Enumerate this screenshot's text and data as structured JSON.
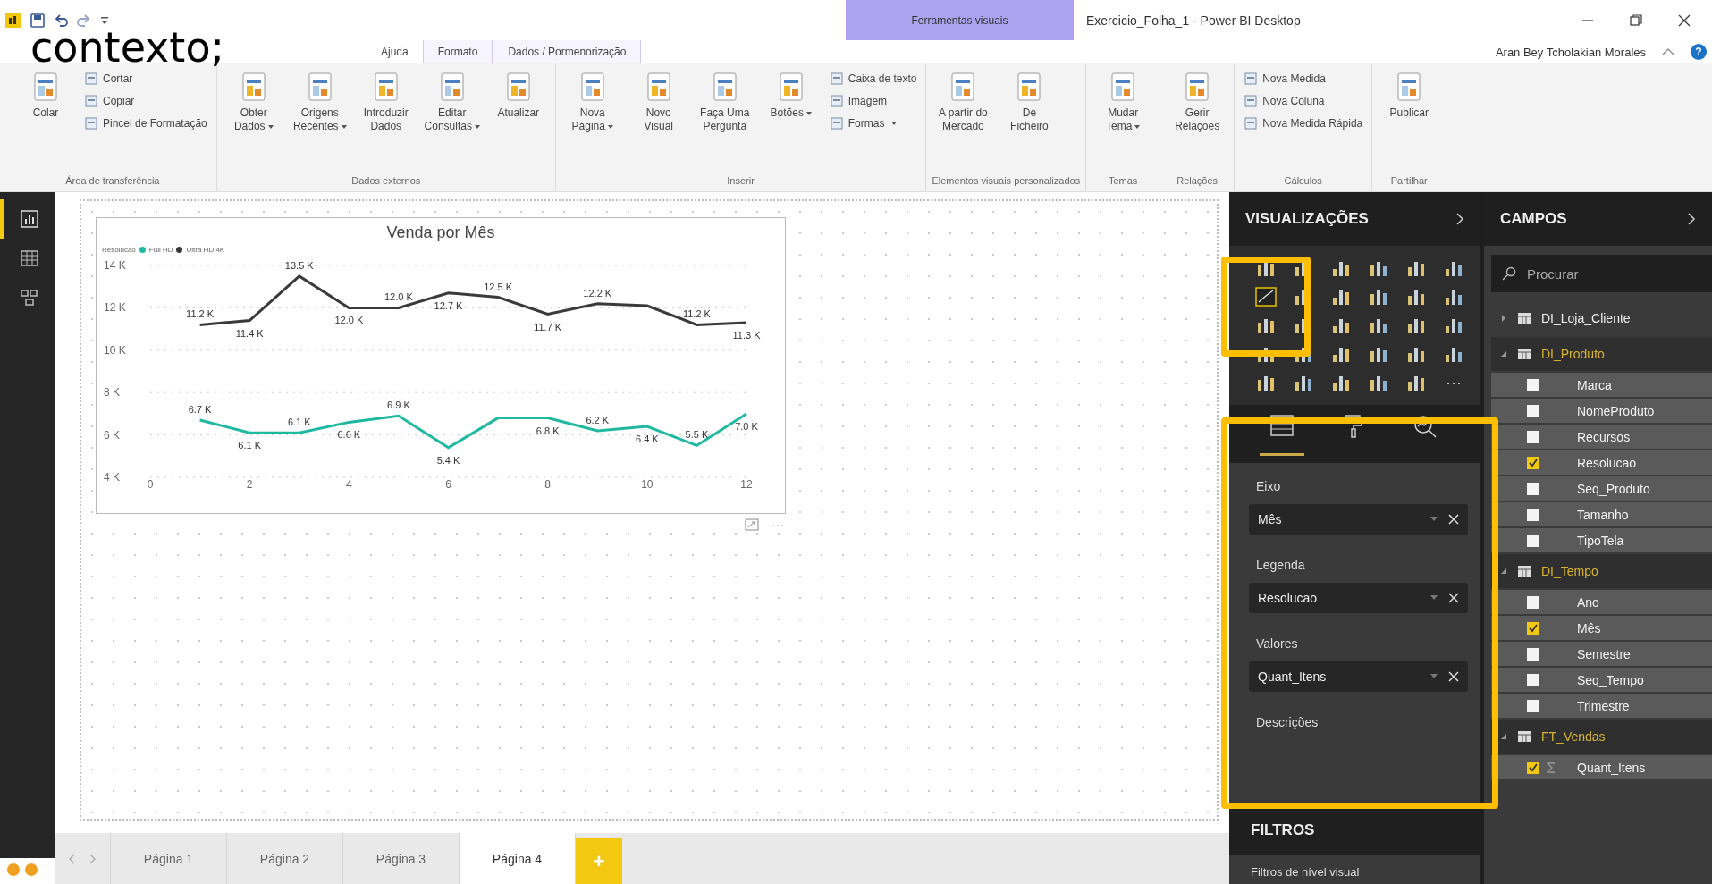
{
  "window": {
    "title": "Exercicio_Folha_1 - Power BI Desktop",
    "contextual_group": "Ferramentas visuais",
    "user": "Aran Bey Tcholakian Morales",
    "help": "?"
  },
  "overlay_caption": "contexto;",
  "menu_tabs": [
    {
      "label": "Ajuda",
      "contextual": false
    },
    {
      "label": "Formato",
      "contextual": true
    },
    {
      "label": "Dados / Pormenorização",
      "contextual": true
    }
  ],
  "ribbon": [
    {
      "label": "Área de transferência",
      "buttons": [
        {
          "lines": [
            "Colar"
          ],
          "kind": "large",
          "menu": false
        },
        {
          "lines": [
            "Cortar"
          ],
          "kind": "small",
          "menu": false
        },
        {
          "lines": [
            "Copiar"
          ],
          "kind": "small",
          "menu": false
        },
        {
          "lines": [
            "Pincel de Formatação"
          ],
          "kind": "small",
          "menu": false
        }
      ]
    },
    {
      "label": "Dados externos",
      "buttons": [
        {
          "lines": [
            "Obter",
            "Dados"
          ],
          "kind": "large",
          "menu": true
        },
        {
          "lines": [
            "Origens",
            "Recentes"
          ],
          "kind": "large",
          "menu": true
        },
        {
          "lines": [
            "Introduzir",
            "Dados"
          ],
          "kind": "large",
          "menu": false
        },
        {
          "lines": [
            "Editar",
            "Consultas"
          ],
          "kind": "large",
          "menu": true
        },
        {
          "lines": [
            "Atualizar"
          ],
          "kind": "large",
          "menu": false
        }
      ]
    },
    {
      "label": "Inserir",
      "buttons": [
        {
          "lines": [
            "Nova",
            "Página"
          ],
          "kind": "large",
          "menu": true
        },
        {
          "lines": [
            "Novo",
            "Visual"
          ],
          "kind": "large",
          "menu": false
        },
        {
          "lines": [
            "Faça Uma",
            "Pergunta"
          ],
          "kind": "large",
          "menu": false
        },
        {
          "lines": [
            "Botões"
          ],
          "kind": "large",
          "menu": true
        },
        {
          "lines": [
            "Caixa de texto"
          ],
          "kind": "small",
          "menu": false
        },
        {
          "lines": [
            "Imagem"
          ],
          "kind": "small",
          "menu": false
        },
        {
          "lines": [
            "Formas"
          ],
          "kind": "small",
          "menu": true
        }
      ]
    },
    {
      "label": "Elementos visuais personalizados",
      "buttons": [
        {
          "lines": [
            "A partir do",
            "Mercado"
          ],
          "kind": "large",
          "menu": false
        },
        {
          "lines": [
            "De",
            "Ficheiro"
          ],
          "kind": "large",
          "menu": false
        }
      ]
    },
    {
      "label": "Temas",
      "buttons": [
        {
          "lines": [
            "Mudar",
            "Tema"
          ],
          "kind": "large",
          "menu": true
        }
      ]
    },
    {
      "label": "Relações",
      "buttons": [
        {
          "lines": [
            "Gerir",
            "Relações"
          ],
          "kind": "large",
          "menu": false
        }
      ]
    },
    {
      "label": "Cálculos",
      "buttons": [
        {
          "lines": [
            "Nova Medida"
          ],
          "kind": "small",
          "menu": false
        },
        {
          "lines": [
            "Nova Coluna"
          ],
          "kind": "small",
          "menu": false
        },
        {
          "lines": [
            "Nova Medida Rápida"
          ],
          "kind": "small",
          "menu": false
        }
      ]
    },
    {
      "label": "Partilhar",
      "buttons": [
        {
          "lines": [
            "Publicar"
          ],
          "kind": "large",
          "menu": false
        }
      ]
    }
  ],
  "nav": [
    {
      "selected": true
    },
    {
      "selected": false
    },
    {
      "selected": false
    }
  ],
  "visual": {
    "more": "···",
    "chart_data": {
      "type": "line",
      "title": "Venda por Mês",
      "legend_title": "Resolucao",
      "x": [
        1,
        2,
        3,
        4,
        5,
        6,
        7,
        8,
        9,
        10,
        11,
        12
      ],
      "xlim": [
        0,
        12
      ],
      "ylim": [
        4000,
        14000
      ],
      "xticks": [
        0,
        2,
        4,
        6,
        8,
        10,
        12
      ],
      "yticks": [
        {
          "value": 4000,
          "label": "4 K"
        },
        {
          "value": 6000,
          "label": "6 K"
        },
        {
          "value": 8000,
          "label": "8 K"
        },
        {
          "value": 10000,
          "label": "10 K"
        },
        {
          "value": 12000,
          "label": "12 K"
        },
        {
          "value": 14000,
          "label": "14 K"
        }
      ],
      "grid": true,
      "series": [
        {
          "name": "Full HD",
          "color": "#1fb8a0",
          "values": [
            6700,
            6100,
            6100,
            6600,
            6900,
            5400,
            6800,
            6800,
            6200,
            6400,
            5500,
            7000
          ],
          "value_labels": [
            "6.7 K",
            "6.1 K",
            "6.1 K",
            "6.6 K",
            "6.9 K",
            "5.4 K",
            null,
            "6.8 K",
            "6.2 K",
            "6.4 K",
            "5.5 K",
            "7.0 K"
          ]
        },
        {
          "name": "Ultra HD 4K",
          "color": "#3a3a3a",
          "values": [
            11200,
            11400,
            13500,
            12000,
            12000,
            12700,
            12500,
            11700,
            12200,
            12100,
            11200,
            11300
          ],
          "value_labels": [
            "11.2 K",
            "11.4 K",
            "13.5 K",
            "12.0 K",
            "12.0 K",
            "12.7 K",
            "12.5 K",
            "11.7 K",
            "12.2 K",
            null,
            "11.2 K",
            "11.3 K"
          ]
        }
      ]
    }
  },
  "visualizations": {
    "title": "VISUALIZAÇÕES",
    "more": "···",
    "gallery": [
      {
        "selected": false
      },
      {
        "selected": false
      },
      {
        "selected": false
      },
      {
        "selected": false
      },
      {
        "selected": false
      },
      {
        "selected": false
      },
      {
        "selected": true
      },
      {
        "selected": false
      },
      {
        "selected": false
      },
      {
        "selected": false
      },
      {
        "selected": false
      },
      {
        "selected": false
      },
      {
        "selected": false
      },
      {
        "selected": false
      },
      {
        "selected": false
      },
      {
        "selected": false
      },
      {
        "selected": false
      },
      {
        "selected": false
      },
      {
        "selected": false
      },
      {
        "selected": false
      },
      {
        "selected": false
      },
      {
        "selected": false
      },
      {
        "selected": false
      },
      {
        "selected": false
      },
      {
        "selected": false
      },
      {
        "selected": false
      },
      {
        "selected": false
      },
      {
        "selected": false
      },
      {
        "selected": false
      }
    ],
    "pane_tabs": [
      {
        "selected": true
      },
      {
        "selected": false
      },
      {
        "selected": false
      }
    ],
    "wells": [
      {
        "label": "Eixo",
        "value": "Mês"
      },
      {
        "label": "Legenda",
        "value": "Resolucao"
      },
      {
        "label": "Valores",
        "value": "Quant_Itens"
      },
      {
        "label": "Descrições"
      }
    ]
  },
  "filters": {
    "title": "FILTROS",
    "subtitle": "Filtros de nível visual"
  },
  "fields": {
    "title": "CAMPOS",
    "placeholder": "Procurar",
    "tables": [
      {
        "name": "DI_Loja_Cliente",
        "expanded": false
      },
      {
        "name": "DI_Produto",
        "expanded": true,
        "children": [
          {
            "name": "Marca",
            "checked": false,
            "kind": "column"
          },
          {
            "name": "NomeProduto",
            "checked": false,
            "kind": "column"
          },
          {
            "name": "Recursos",
            "checked": false,
            "kind": "column"
          },
          {
            "name": "Resolucao",
            "checked": true,
            "kind": "column"
          },
          {
            "name": "Seq_Produto",
            "checked": false,
            "kind": "column"
          },
          {
            "name": "Tamanho",
            "checked": false,
            "kind": "column"
          },
          {
            "name": "TipoTela",
            "checked": false,
            "kind": "column"
          }
        ]
      },
      {
        "name": "DI_Tempo",
        "expanded": true,
        "children": [
          {
            "name": "Ano",
            "checked": false,
            "kind": "column"
          },
          {
            "name": "Mês",
            "checked": true,
            "kind": "column"
          },
          {
            "name": "Semestre",
            "checked": false,
            "kind": "column"
          },
          {
            "name": "Seq_Tempo",
            "checked": false,
            "kind": "column"
          },
          {
            "name": "Trimestre",
            "checked": false,
            "kind": "column"
          }
        ]
      },
      {
        "name": "FT_Vendas",
        "expanded": true,
        "children": [
          {
            "name": "Quant_Itens",
            "checked": true,
            "kind": "sum"
          }
        ]
      }
    ]
  },
  "pages": {
    "add": "+",
    "tabs": [
      {
        "label": "Página 1",
        "selected": false
      },
      {
        "label": "Página 2",
        "selected": false
      },
      {
        "label": "Página 3",
        "selected": false
      },
      {
        "label": "Página 4",
        "selected": true
      }
    ]
  }
}
